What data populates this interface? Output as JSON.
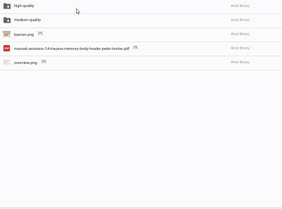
{
  "files": [
    {
      "name": "high-quality",
      "owner": "Arnd library",
      "icon": "folder-icon",
      "shared": false
    },
    {
      "name": "medium-quality",
      "owner": "Arnd library",
      "icon": "folder-icon",
      "shared": false
    },
    {
      "name": "banner.png",
      "owner": "Arnd library",
      "icon": "image-icon",
      "shared": true
    },
    {
      "name": "manual-sessions-14-trauma-memory-body-healer-peter-levine.pdf",
      "owner": "Arnd library",
      "icon": "pdf-icon",
      "shared": true
    },
    {
      "name": "overview.png",
      "owner": "Arnd library",
      "icon": "image-icon",
      "shared": true
    }
  ],
  "colors": {
    "folder": "#5f6368",
    "pdf": "#d93025",
    "text": "#2a2a2e",
    "owner": "#9a9aa2"
  }
}
